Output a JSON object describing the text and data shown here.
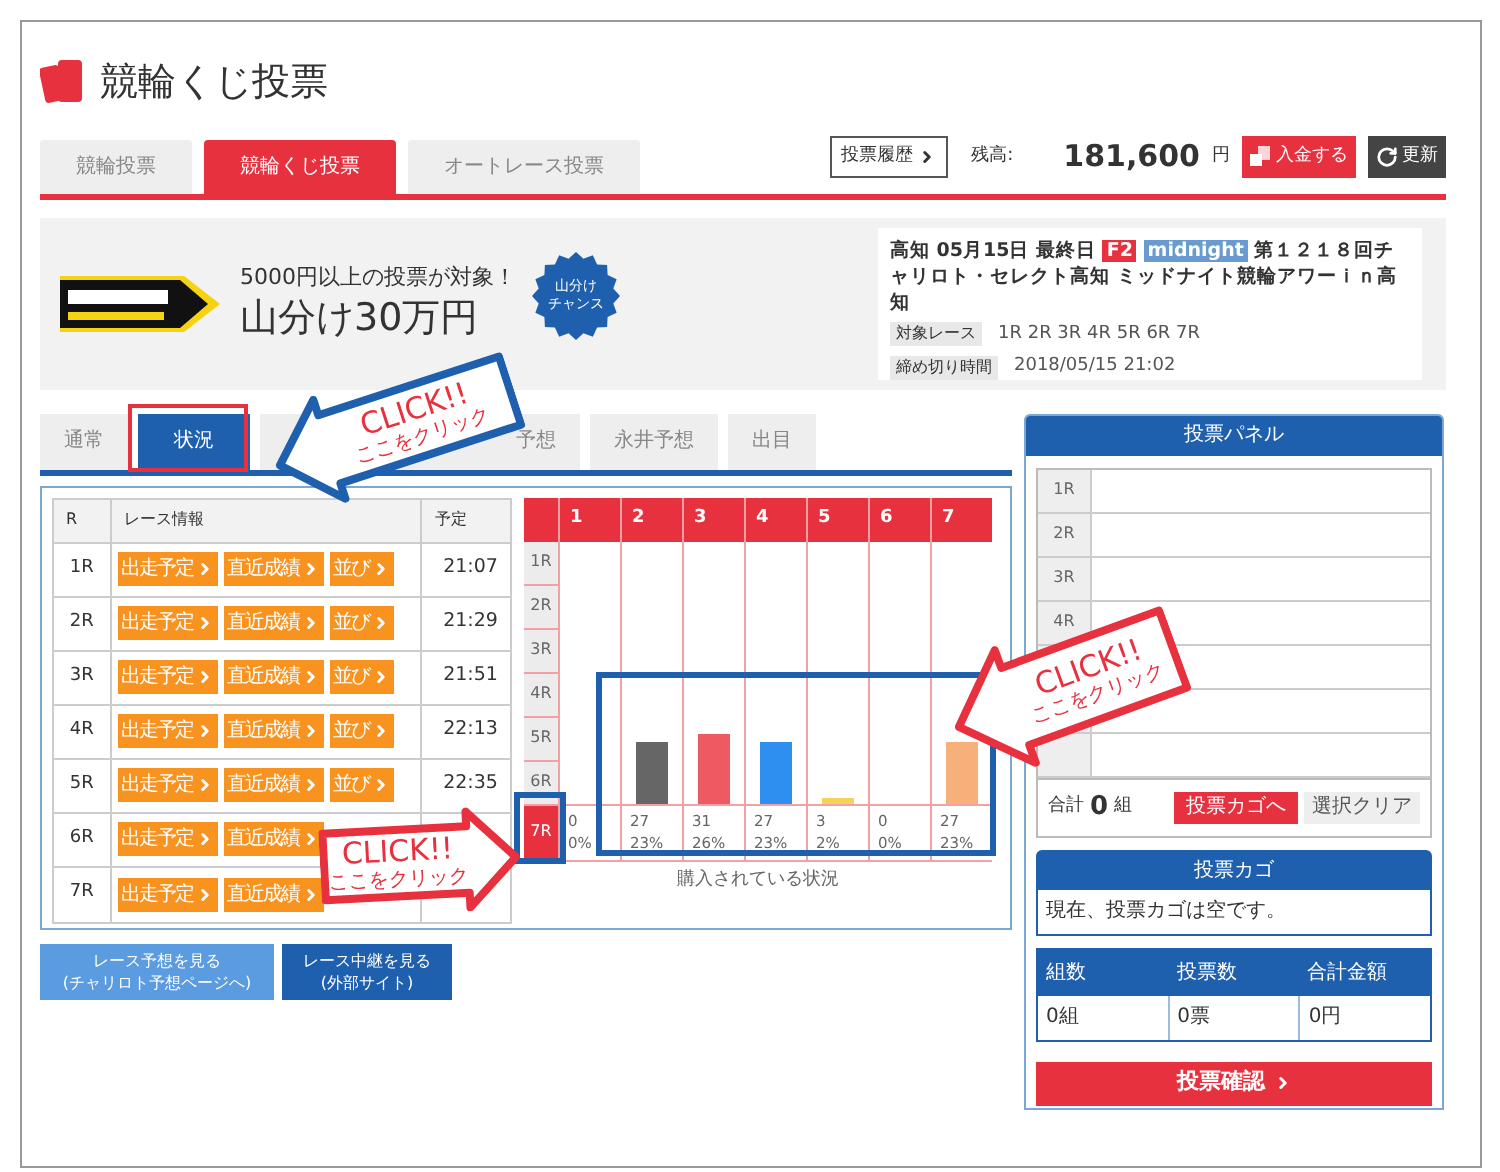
{
  "header": {
    "title": "競輪くじ投票"
  },
  "main_tabs": [
    {
      "label": "競輪投票",
      "selected": false
    },
    {
      "label": "競輪くじ投票",
      "selected": true
    },
    {
      "label": "オートレース投票",
      "selected": false
    }
  ],
  "history_button": "投票履歴",
  "balance": {
    "label": "残高:",
    "amount": "181,600",
    "unit": "円"
  },
  "deposit_button": "入金する",
  "refresh_button": "更新",
  "banner": {
    "note": "5000円以上の投票が対象！",
    "headline": "山分け30万円",
    "badge_lines": [
      "山分け",
      "チャンス"
    ]
  },
  "race_info": {
    "venue_date": "高知 05月15日 最終日",
    "grade": "F2",
    "tag": "midnight",
    "title": "第１２１８回チャリロト・セレクト高知 ミッドナイト競輪アワーｉｎ高知",
    "target_label": "対象レース",
    "target_races": "1R 2R 3R 4R 5R 6R 7R",
    "deadline_label": "締め切り時間",
    "deadline": "2018/05/15 21:02"
  },
  "sub_tabs": [
    {
      "label": "通常",
      "selected": false
    },
    {
      "label": "状況",
      "selected": true
    },
    {
      "label": "予想",
      "selected": false
    },
    {
      "label": "永井予想",
      "selected": false
    },
    {
      "label": "出目",
      "selected": false
    }
  ],
  "race_table": {
    "columns": [
      "R",
      "レース情報",
      "予定"
    ],
    "rows": [
      {
        "race": "1R",
        "buttons": [
          "出走予定",
          "直近成績",
          "並び"
        ],
        "time": "21:07"
      },
      {
        "race": "2R",
        "buttons": [
          "出走予定",
          "直近成績",
          "並び"
        ],
        "time": "21:29"
      },
      {
        "race": "3R",
        "buttons": [
          "出走予定",
          "直近成績",
          "並び"
        ],
        "time": "21:51"
      },
      {
        "race": "4R",
        "buttons": [
          "出走予定",
          "直近成績",
          "並び"
        ],
        "time": "22:13"
      },
      {
        "race": "5R",
        "buttons": [
          "出走予定",
          "直近成績",
          "並び"
        ],
        "time": "22:35"
      },
      {
        "race": "6R",
        "buttons": [
          "出走予定",
          "直近成績"
        ]
      },
      {
        "race": "7R",
        "buttons": [
          "出走予定",
          "直近成績"
        ]
      }
    ]
  },
  "chart": {
    "columns": [
      {
        "label": "1",
        "count": "0",
        "percent": "0%"
      },
      {
        "label": "2",
        "count": "27",
        "percent": "23%",
        "level": 0.23,
        "color": "#666666"
      },
      {
        "label": "3",
        "count": "31",
        "percent": "26%",
        "level": 0.26,
        "color": "#ee5a62"
      },
      {
        "label": "4",
        "count": "27",
        "percent": "23%",
        "level": 0.23,
        "color": "#2f8ff0"
      },
      {
        "label": "5",
        "count": "3",
        "percent": "2%",
        "level": 0.02,
        "color": "#f5d25a"
      },
      {
        "label": "6",
        "count": "0",
        "percent": "0%"
      },
      {
        "label": "7",
        "count": "27",
        "percent": "23%",
        "level": 0.23,
        "color": "#f7b07a"
      }
    ],
    "rows": [
      {
        "label": "1R",
        "selected": false
      },
      {
        "label": "2R",
        "selected": false
      },
      {
        "label": "3R",
        "selected": false
      },
      {
        "label": "4R",
        "selected": false
      },
      {
        "label": "5R",
        "selected": false
      },
      {
        "label": "6R",
        "selected": false
      },
      {
        "label": "7R",
        "selected": true
      }
    ],
    "caption": "購入されている状況"
  },
  "links": [
    {
      "kind": "forecast",
      "lines": [
        "レース予想を見る",
        "(チャリロト予想ページへ)"
      ]
    },
    {
      "kind": "live",
      "lines": [
        "レース中継を見る",
        "(外部サイト)"
      ]
    }
  ],
  "vote_panel": {
    "title": "投票パネル",
    "rows": [
      "1R",
      "2R",
      "3R",
      "4R"
    ],
    "total_label": "合計",
    "total_value": "0",
    "total_unit": "組",
    "basket_button": "投票カゴへ",
    "clear_button": "選択クリア"
  },
  "basket": {
    "title": "投票カゴ",
    "message": "現在、投票カゴは空です。",
    "columns": [
      "組数",
      "投票数",
      "合計金額"
    ],
    "values": [
      "0組",
      "0票",
      "0円"
    ],
    "confirm_button": "投票確認"
  },
  "callouts": [
    {
      "kind": "tab",
      "title": "CLICK!!",
      "text": "ここをクリック"
    },
    {
      "kind": "row",
      "title": "CLICK!!",
      "text": "ここをクリック"
    },
    {
      "kind": "chart",
      "title": "CLICK!!",
      "text": "ここをクリック"
    }
  ]
}
